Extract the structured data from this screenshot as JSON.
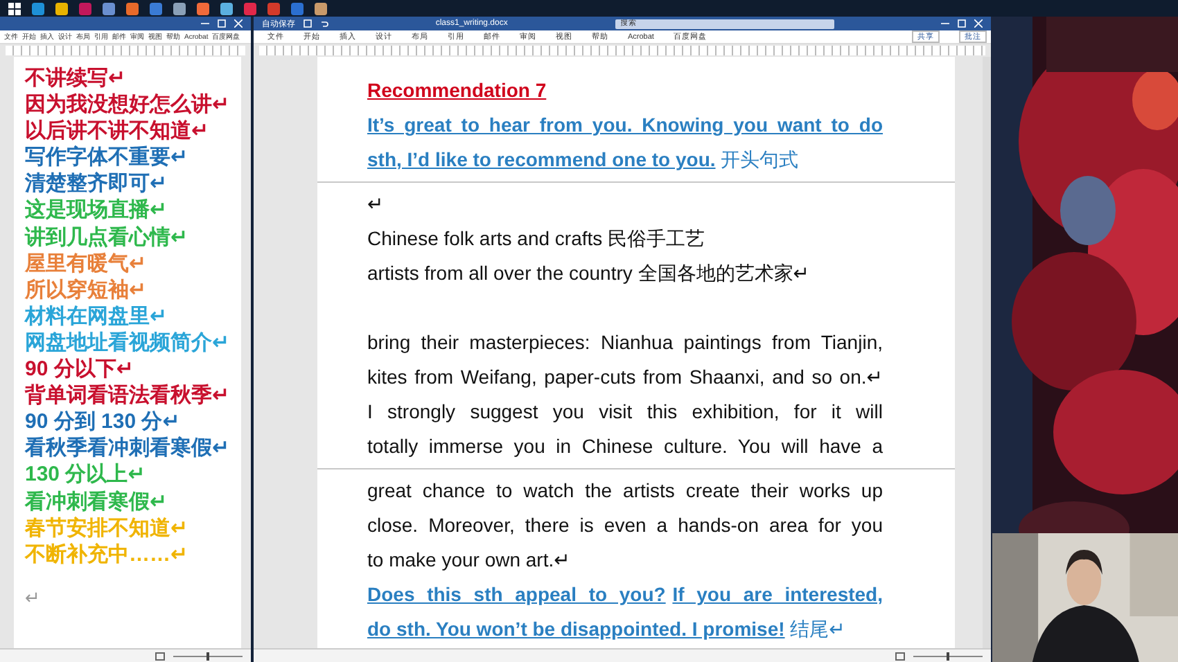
{
  "left_document": {
    "menu": [
      "文件",
      "开始",
      "插入",
      "设计",
      "布局",
      "引用",
      "邮件",
      "审阅",
      "视图",
      "帮助",
      "Acrobat",
      "百度网盘"
    ],
    "lines": [
      {
        "text": "不讲续写↵",
        "color": "#c8102e"
      },
      {
        "text": "因为我没想好怎么讲↵",
        "color": "#c8102e"
      },
      {
        "text": "以后讲不讲不知道↵",
        "color": "#c8102e"
      },
      {
        "text": "写作字体不重要↵",
        "color": "#1f6fb5"
      },
      {
        "text": "清楚整齐即可↵",
        "color": "#1f6fb5"
      },
      {
        "text": "这是现场直播↵",
        "color": "#2eb84c"
      },
      {
        "text": "讲到几点看心情↵",
        "color": "#2eb84c"
      },
      {
        "text": "屋里有暖气↵",
        "color": "#e8803a"
      },
      {
        "text": "所以穿短袖↵",
        "color": "#e8803a"
      },
      {
        "text": "材料在网盘里↵",
        "color": "#2aa5d8"
      },
      {
        "text": "网盘地址看视频简介↵",
        "color": "#2aa5d8"
      },
      {
        "text": "90 分以下↵",
        "color": "#c8102e"
      },
      {
        "text": "背单词看语法看秋季↵",
        "color": "#c8102e"
      },
      {
        "text": "90 分到 130 分↵",
        "color": "#1f6fb5"
      },
      {
        "text": "看秋季看冲刺看寒假↵",
        "color": "#1f6fb5"
      },
      {
        "text": "130 分以上↵",
        "color": "#2eb84c"
      },
      {
        "text": "看冲刺看寒假↵",
        "color": "#2eb84c"
      },
      {
        "text": "春节安排不知道↵",
        "color": "#f0b400"
      },
      {
        "text": "不断补充中……↵",
        "color": "#f0b400"
      }
    ],
    "trailing_mark": "↵",
    "zoom": {
      "level": 0.5
    }
  },
  "main_document": {
    "autosave_label": "自动保存",
    "title": "class1_writing.docx",
    "search": {
      "placeholder": "搜索"
    },
    "menu": [
      "文件",
      "开始",
      "插入",
      "设计",
      "布局",
      "引用",
      "邮件",
      "审阅",
      "视图",
      "帮助",
      "Acrobat",
      "百度网盘"
    ],
    "actions": [
      "共享",
      "批注"
    ],
    "zoom": {
      "level": 0.5
    },
    "lines": [
      {
        "kind": "text",
        "segments": [
          {
            "text": "Recommendation 7",
            "kind": "heading"
          }
        ]
      },
      {
        "kind": "wrapped",
        "segments": [
          {
            "text": "It’s great to hear from you. Knowing you want to do",
            "kind": "emph"
          }
        ]
      },
      {
        "kind": "text",
        "segments": [
          {
            "text": "sth, I’d like to recommend one to you.",
            "kind": "emph"
          },
          {
            "text": "  开头句式",
            "kind": "note"
          }
        ]
      },
      {
        "kind": "page_break"
      },
      {
        "kind": "text",
        "segments": [
          {
            "text": "↵",
            "kind": "plain"
          }
        ]
      },
      {
        "kind": "text",
        "segments": [
          {
            "text": "Chinese folk arts and crafts  民俗手工艺",
            "kind": "plain"
          }
        ]
      },
      {
        "kind": "text",
        "segments": [
          {
            "text": "artists from all over the country  全国各地的艺术家↵",
            "kind": "plain"
          }
        ]
      },
      {
        "kind": "blank"
      },
      {
        "kind": "wrapped",
        "segments": [
          {
            "text": " bring their masterpieces: Nianhua paintings from Tianjin,",
            "kind": "plain"
          }
        ]
      },
      {
        "kind": "wrapped",
        "segments": [
          {
            "text": "kites from Weifang, paper-cuts from Shaanxi, and so on.↵",
            "kind": "plain"
          }
        ]
      },
      {
        "kind": "wrapped",
        "segments": [
          {
            "text": " I strongly suggest you visit this exhibition, for it will",
            "kind": "plain"
          }
        ]
      },
      {
        "kind": "wrapped",
        "segments": [
          {
            "text": "totally immerse you in Chinese culture. You will have a",
            "kind": "plain"
          }
        ]
      },
      {
        "kind": "page_break"
      },
      {
        "kind": "wrapped",
        "segments": [
          {
            "text": "great chance to watch the artists create their works up",
            "kind": "plain"
          }
        ]
      },
      {
        "kind": "wrapped",
        "segments": [
          {
            "text": "close. Moreover, there is even a hands-on area for you",
            "kind": "plain"
          }
        ]
      },
      {
        "kind": "text",
        "segments": [
          {
            "text": "to make your own art.↵",
            "kind": "plain"
          }
        ]
      },
      {
        "kind": "wrapped",
        "segments": [
          {
            "text": "Does this sth appeal to you?",
            "kind": "emph"
          },
          {
            "text": "If you are interested,",
            "kind": "emph"
          }
        ]
      },
      {
        "kind": "text",
        "segments": [
          {
            "text": "do sth. You won’t be disappointed. I promise!",
            "kind": "emph"
          },
          {
            "text": "  结尾↵",
            "kind": "note"
          }
        ]
      }
    ]
  }
}
